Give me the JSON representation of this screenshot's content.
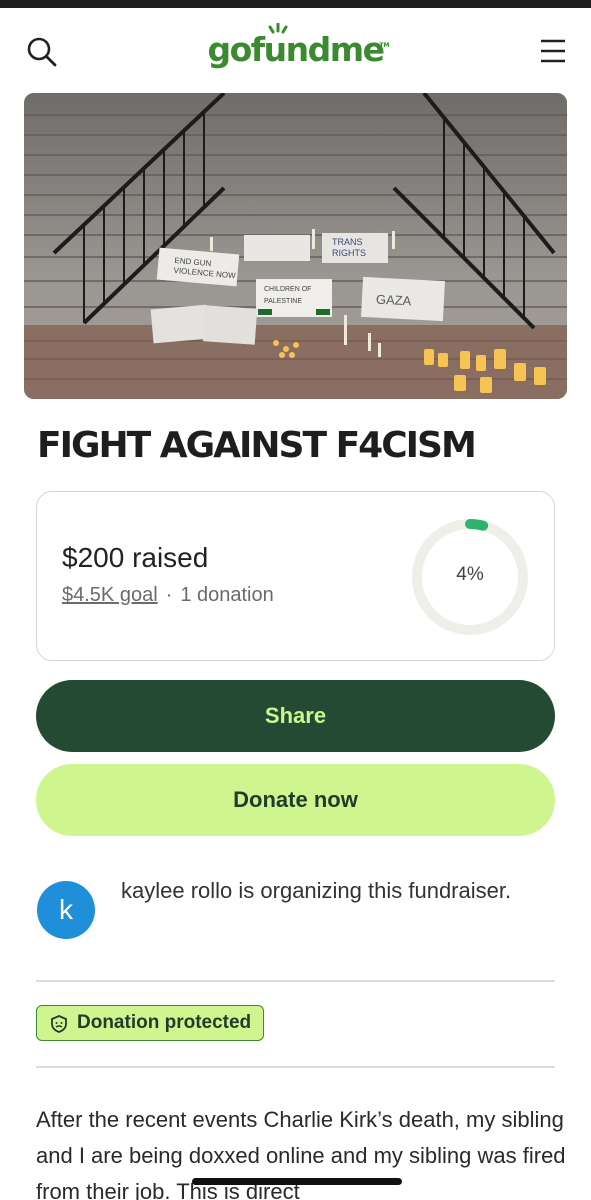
{
  "header": {
    "logo_text": "gofundme",
    "logo_tm": "TM",
    "search_icon": "search-icon",
    "menu_icon": "hamburger-menu-icon"
  },
  "campaign": {
    "title": "FIGHT AGAINST F4CISM",
    "image_signs": [
      "END GUN VIOLENCE NOW",
      "TRANS RIGHTS",
      "CHILDREN OF PALESTINE",
      "GAZA"
    ]
  },
  "progress": {
    "raised": "$200 raised",
    "goal": "$4.5K goal",
    "separator": "·",
    "donations": "1 donation",
    "percent_label": "4%",
    "percent_value": 0.04
  },
  "buttons": {
    "share": "Share",
    "donate": "Donate now"
  },
  "organizer": {
    "avatar_letter": "k",
    "text": "kaylee rollo is organizing this fundraiser."
  },
  "badge": {
    "label": "Donation protected",
    "icon": "shield-icon"
  },
  "story": {
    "text": "After the recent events Charlie Kirk’s death, my sibling and I are being doxxed online and my sibling was fired from their job. This is direct"
  },
  "colors": {
    "brand_green": "#3a8a2f",
    "share_bg": "#244a33",
    "share_text": "#c8f78d",
    "donate_bg": "#cff58e",
    "avatar_bg": "#1e8fd8",
    "progress_green": "#2fb36b"
  }
}
